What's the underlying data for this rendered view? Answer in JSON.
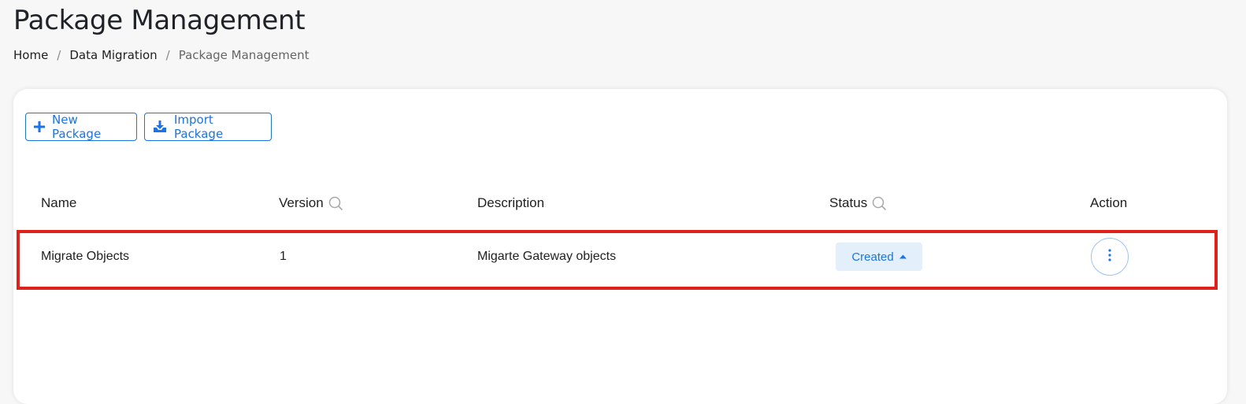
{
  "page": {
    "title": "Package Management"
  },
  "breadcrumb": [
    {
      "label": "Home"
    },
    {
      "label": "Data Migration"
    },
    {
      "label": "Package Management"
    }
  ],
  "breadcrumb_separator": "/",
  "toolbar": {
    "new_package_label": "New Package",
    "new_package_icon": "plus-icon",
    "import_package_label": "Import Package",
    "import_package_icon": "download-icon"
  },
  "table": {
    "columns": [
      {
        "label": "Name",
        "searchable": false
      },
      {
        "label": "Version",
        "searchable": true
      },
      {
        "label": "Description",
        "searchable": false
      },
      {
        "label": "Status",
        "searchable": true
      },
      {
        "label": "Action",
        "searchable": false
      }
    ],
    "rows": [
      {
        "name": "Migrate Objects",
        "version": "1",
        "description": "Migarte Gateway objects",
        "status": "Created",
        "highlighted": true
      }
    ]
  },
  "colors": {
    "accent": "#1a73e8",
    "highlight_border": "#e0201b",
    "status_pill_bg": "#e3f0fc"
  }
}
